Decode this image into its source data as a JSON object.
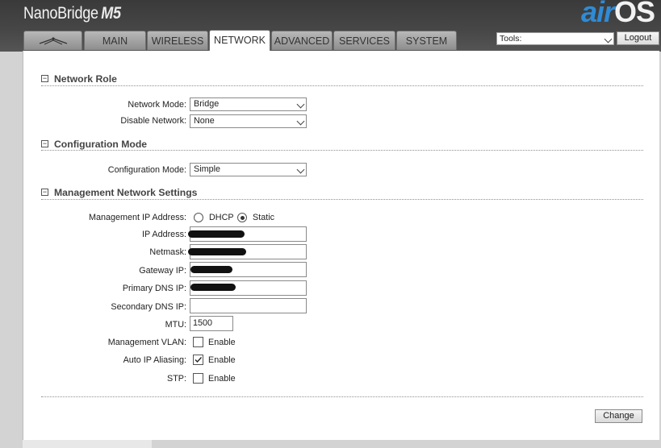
{
  "header": {
    "brand": "NanoBridge",
    "brand_model": "M5",
    "logo_air": "air",
    "logo_os": "OS"
  },
  "tabs": [
    {
      "label": "",
      "icon": "ubiquiti-antenna-icon"
    },
    {
      "label": "MAIN"
    },
    {
      "label": "WIRELESS"
    },
    {
      "label": "NETWORK",
      "active": true
    },
    {
      "label": "ADVANCED"
    },
    {
      "label": "SERVICES"
    },
    {
      "label": "SYSTEM"
    }
  ],
  "tools": {
    "label": "Tools:",
    "logout_label": "Logout"
  },
  "sections": {
    "network_role": {
      "title": "Network Role",
      "collapse": "−"
    },
    "config_mode": {
      "title": "Configuration Mode",
      "collapse": "−"
    },
    "mgmt": {
      "title": "Management Network Settings",
      "collapse": "−"
    }
  },
  "network_role": {
    "network_mode_label": "Network Mode:",
    "network_mode_value": "Bridge",
    "disable_network_label": "Disable Network:",
    "disable_network_value": "None"
  },
  "config_mode": {
    "label": "Configuration Mode:",
    "value": "Simple"
  },
  "mgmt": {
    "ip_mode_label": "Management IP Address:",
    "dhcp_label": "DHCP",
    "static_label": "Static",
    "selected": "Static",
    "ip_label": "IP Address:",
    "netmask_label": "Netmask:",
    "gateway_label": "Gateway IP:",
    "primary_dns_label": "Primary DNS IP:",
    "secondary_dns_label": "Secondary DNS IP:",
    "mtu_label": "MTU:",
    "mtu_value": "1500",
    "vlan_label": "Management VLAN:",
    "vlan_enable": "Enable",
    "vlan_checked": false,
    "aliasing_label": "Auto IP Aliasing:",
    "aliasing_enable": "Enable",
    "aliasing_checked": true,
    "stp_label": "STP:",
    "stp_enable": "Enable",
    "stp_checked": false
  },
  "actions": {
    "change_label": "Change"
  },
  "colors": {
    "accent": "#2f8bd5",
    "header": "#444444"
  }
}
